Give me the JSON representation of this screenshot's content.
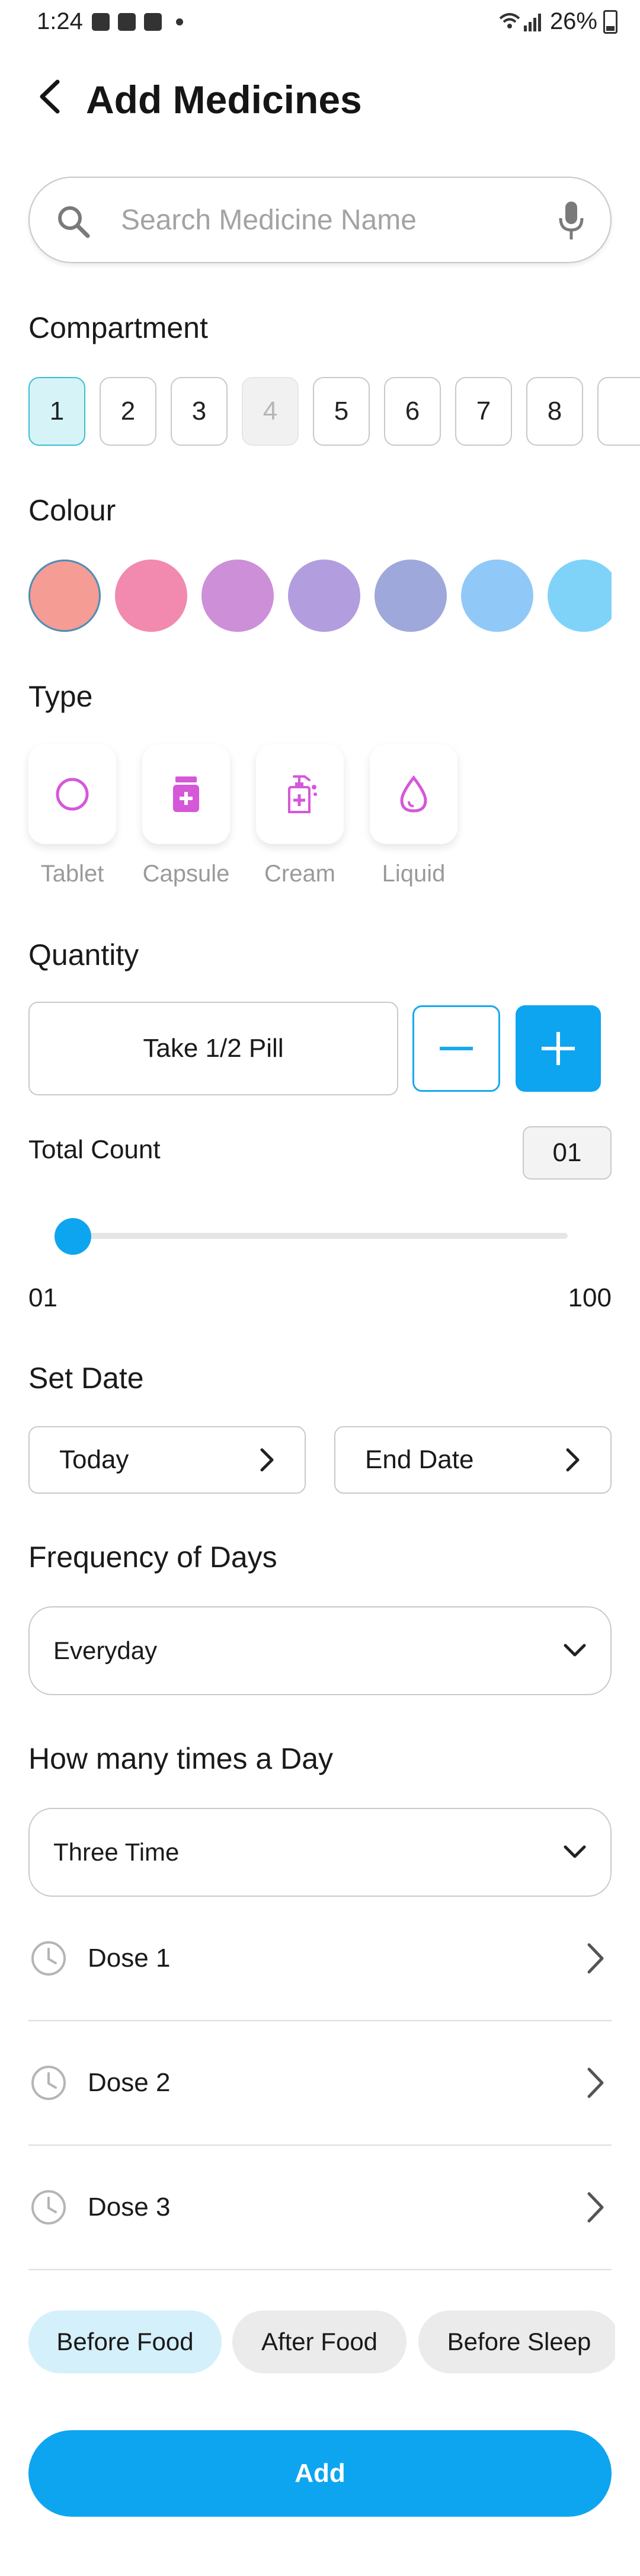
{
  "status_bar": {
    "time": "1:24",
    "battery": "26%"
  },
  "header": {
    "title": "Add Medicines"
  },
  "search": {
    "placeholder": "Search Medicine Name"
  },
  "compartment": {
    "label": "Compartment",
    "items": [
      "1",
      "2",
      "3",
      "4",
      "5",
      "6",
      "7",
      "8",
      ""
    ],
    "selected": "1",
    "disabled": [
      "4"
    ]
  },
  "colour": {
    "label": "Colour",
    "swatches": [
      "#f59c95",
      "#f18aae",
      "#cd8fd8",
      "#b29ddf",
      "#9fa8db",
      "#90c9f8",
      "#80d3f8"
    ],
    "selected_index": 0
  },
  "type": {
    "label": "Type",
    "items": [
      {
        "label": "Tablet",
        "icon": "circle-outline-icon"
      },
      {
        "label": "Capsule",
        "icon": "medicine-bottle-icon"
      },
      {
        "label": "Cream",
        "icon": "dispenser-bottle-icon"
      },
      {
        "label": "Liquid",
        "icon": "drop-icon"
      }
    ],
    "accent": "#d558d8"
  },
  "quantity": {
    "label": "Quantity",
    "value": "Take 1/2 Pill",
    "total_label": "Total Count",
    "total_value": "01",
    "slider_min": "01",
    "slider_max": "100",
    "slider_value": 1
  },
  "set_date": {
    "label": "Set Date",
    "start": "Today",
    "end": "End Date"
  },
  "frequency": {
    "label": "Frequency of Days",
    "value": "Everyday"
  },
  "times_per_day": {
    "label": "How many times a Day",
    "value": "Three Time"
  },
  "doses": [
    "Dose 1",
    "Dose 2",
    "Dose 3"
  ],
  "food_options": [
    "Before Food",
    "After Food",
    "Before Sleep"
  ],
  "food_selected": "Before Food",
  "add_button": "Add",
  "colors": {
    "primary": "#0ea5f0",
    "selected_bg": "#d6f4f8"
  }
}
